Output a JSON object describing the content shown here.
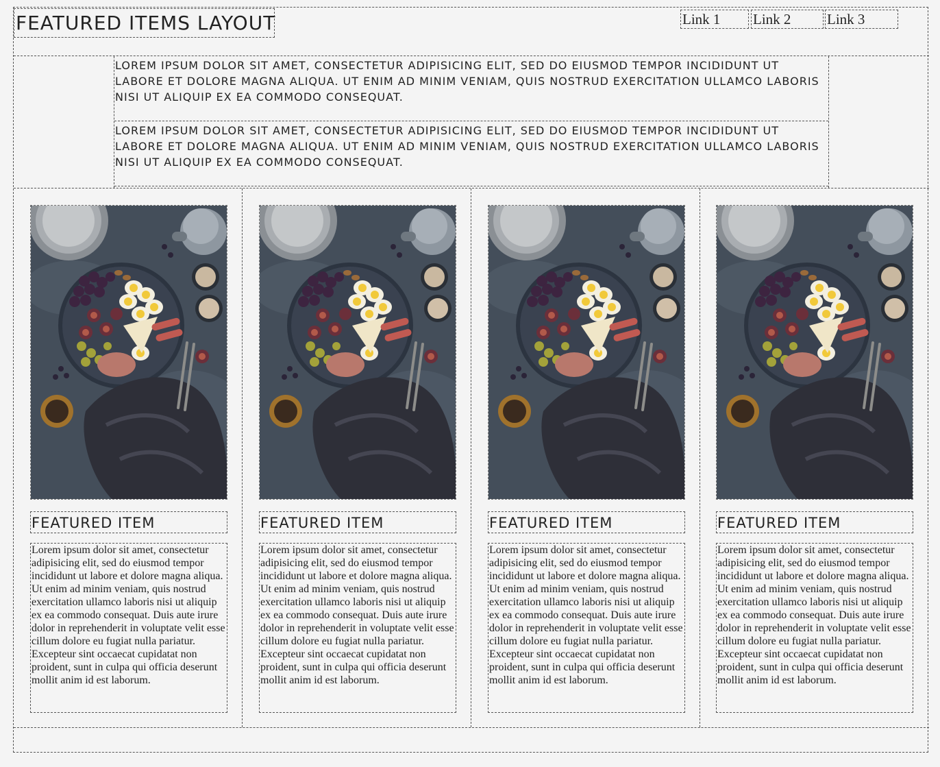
{
  "header": {
    "title": "FEATURED ITEMS LAYOUT",
    "nav": [
      "Link 1",
      "Link 2",
      "Link 3"
    ]
  },
  "intro": {
    "paragraphs": [
      "Lorem ipsum dolor sit amet, consectetur adipisicing elit, sed do eiusmod tempor incididunt ut labore et dolore magna aliqua. Ut enim ad minim veniam, quis nostrud exercitation ullamco laboris nisi ut aliquip ex ea commodo consequat.",
      "Lorem ipsum dolor sit amet, consectetur adipisicing elit, sed do eiusmod tempor incididunt ut labore et dolore magna aliqua. Ut enim ad minim veniam, quis nostrud exercitation ullamco laboris nisi ut aliquip ex ea commodo consequat."
    ]
  },
  "items": [
    {
      "title": "FEATURED ITEM",
      "body": "Lorem ipsum dolor sit amet, consectetur adipisicing elit, sed do eiusmod tempor incididunt ut labore et dolore magna aliqua. Ut enim ad minim veniam, quis nostrud exercitation ullamco laboris nisi ut aliquip ex ea commodo consequat. Duis aute irure dolor in reprehenderit in voluptate velit esse cillum dolore eu fugiat nulla pariatur. Excepteur sint occaecat cupidatat non proident, sunt in culpa qui officia deserunt mollit anim id est laborum."
    },
    {
      "title": "FEATURED ITEM",
      "body": "Lorem ipsum dolor sit amet, consectetur adipisicing elit, sed do eiusmod tempor incididunt ut labore et dolore magna aliqua. Ut enim ad minim veniam, quis nostrud exercitation ullamco laboris nisi ut aliquip ex ea commodo consequat. Duis aute irure dolor in reprehenderit in voluptate velit esse cillum dolore eu fugiat nulla pariatur. Excepteur sint occaecat cupidatat non proident, sunt in culpa qui officia deserunt mollit anim id est laborum."
    },
    {
      "title": "FEATURED ITEM",
      "body": "Lorem ipsum dolor sit amet, consectetur adipisicing elit, sed do eiusmod tempor incididunt ut labore et dolore magna aliqua. Ut enim ad minim veniam, quis nostrud exercitation ullamco laboris nisi ut aliquip ex ea commodo consequat. Duis aute irure dolor in reprehenderit in voluptate velit esse cillum dolore eu fugiat nulla pariatur. Excepteur sint occaecat cupidatat non proident, sunt in culpa qui officia deserunt mollit anim id est laborum."
    },
    {
      "title": "FEATURED ITEM",
      "body": "Lorem ipsum dolor sit amet, consectetur adipisicing elit, sed do eiusmod tempor incididunt ut labore et dolore magna aliqua. Ut enim ad minim veniam, quis nostrud exercitation ullamco laboris nisi ut aliquip ex ea commodo consequat. Duis aute irure dolor in reprehenderit in voluptate velit esse cillum dolore eu fugiat nulla pariatur. Excepteur sint occaecat cupidatat non proident, sunt in culpa qui officia deserunt mollit anim id est laborum."
    }
  ]
}
